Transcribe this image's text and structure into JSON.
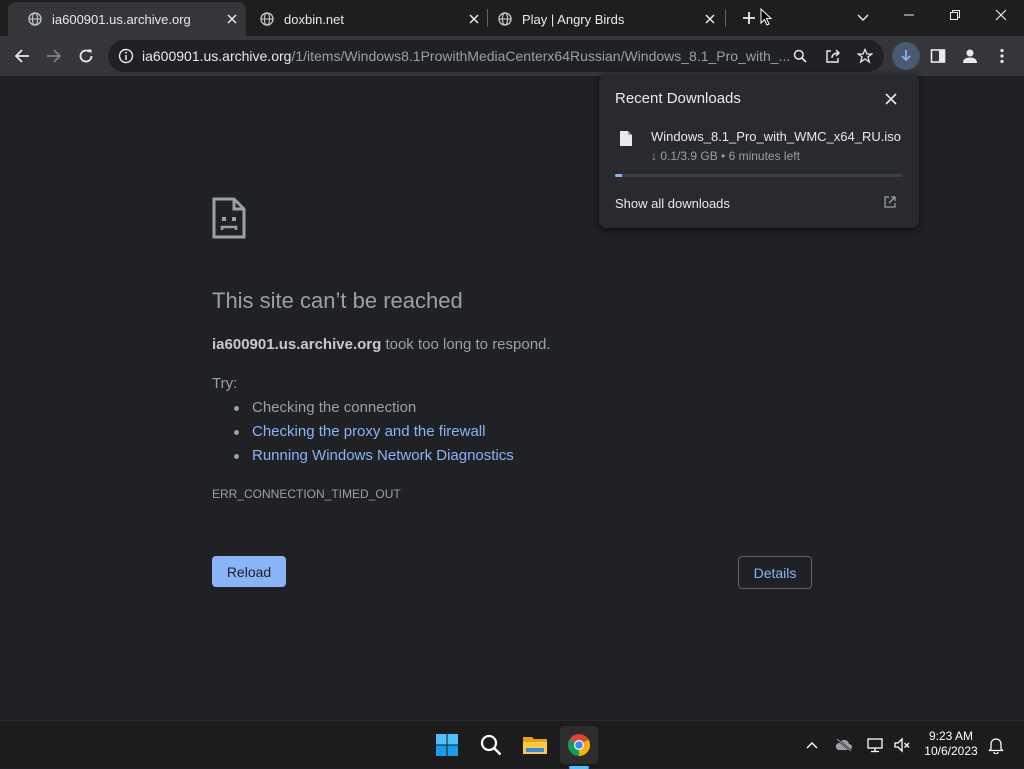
{
  "tabs": [
    {
      "title": "ia600901.us.archive.org",
      "active": true,
      "icon": "globe-icon"
    },
    {
      "title": "doxbin.net",
      "active": false,
      "icon": "globe-icon"
    },
    {
      "title": "Play | Angry Birds",
      "active": false,
      "icon": "globe-icon"
    }
  ],
  "omnibox": {
    "host": "ia600901.us.archive.org",
    "path": "/1/items/Windows8.1ProwithMediaCenterx64Russian/Windows_8.1_Pro_with_..."
  },
  "error_page": {
    "heading": "This site can’t be reached",
    "host": "ia600901.us.archive.org",
    "message": " took too long to respond.",
    "try_label": "Try:",
    "suggestions": [
      "Checking the connection",
      "Checking the proxy and the firewall",
      "Running Windows Network Diagnostics"
    ],
    "error_code": "ERR_CONNECTION_TIMED_OUT",
    "reload_label": "Reload",
    "details_label": "Details"
  },
  "downloads": {
    "title": "Recent Downloads",
    "file_name": "Windows_8.1_Pro_with_WMC_x64_RU.iso",
    "status": "↓ 0.1/3.9 GB • 6 minutes left",
    "progress_fraction": 0.026,
    "show_all_label": "Show all downloads"
  },
  "taskbar": {
    "time": "9:23 AM",
    "date": "10/6/2023",
    "apps": [
      "start-icon",
      "search-icon",
      "file-explorer-icon",
      "chrome-icon"
    ]
  },
  "colors": {
    "accent": "#8ab4f8",
    "page_background": "#202124",
    "toolbar": "#35363a"
  }
}
